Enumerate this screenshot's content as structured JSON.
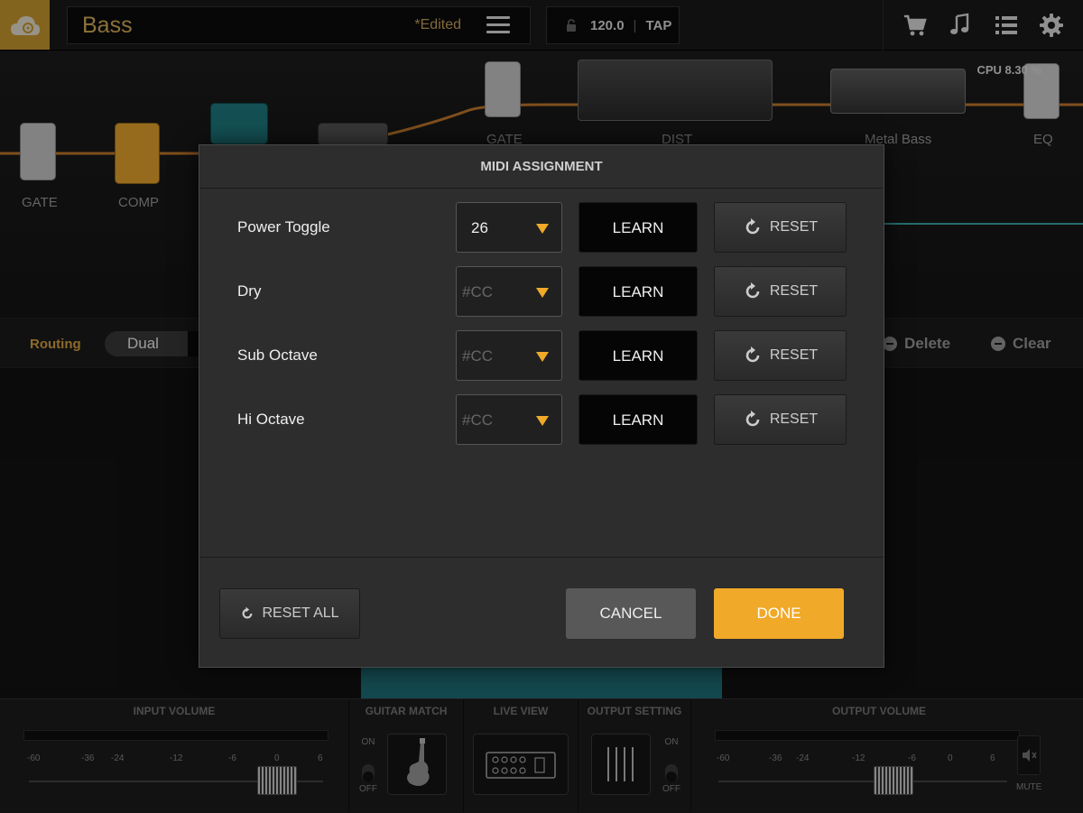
{
  "topbar": {
    "preset_name": "Bass",
    "edited_label": "*Edited",
    "tempo": "120.0",
    "tap_label": "TAP"
  },
  "chain": {
    "cpu_label": "CPU 8.30 %",
    "fx_labels": [
      "GATE",
      "COMP",
      "GATE",
      "DIST",
      "Metal Bass",
      "EQ"
    ]
  },
  "routing": {
    "label": "Routing",
    "mode": "Dual",
    "delete_label": "Delete",
    "clear_label": "Clear"
  },
  "bottom": {
    "input_volume_title": "INPUT VOLUME",
    "guitar_match_title": "GUITAR MATCH",
    "live_view_title": "LIVE VIEW",
    "output_setting_title": "OUTPUT SETTING",
    "output_volume_title": "OUTPUT VOLUME",
    "scale": [
      "-60",
      "-36",
      "-24",
      "-12",
      "-6",
      "0",
      "6"
    ],
    "on_label": "ON",
    "off_label": "OFF",
    "mute_label": "MUTE"
  },
  "dialog": {
    "title": "MIDI ASSIGNMENT",
    "rows": [
      {
        "label": "Power Toggle",
        "cc_value": "26",
        "learn": "LEARN",
        "reset": "RESET"
      },
      {
        "label": "Dry",
        "cc_placeholder": "#CC",
        "learn": "LEARN",
        "reset": "RESET"
      },
      {
        "label": "Sub Octave",
        "cc_placeholder": "#CC",
        "learn": "LEARN",
        "reset": "RESET"
      },
      {
        "label": "Hi Octave",
        "cc_placeholder": "#CC",
        "learn": "LEARN",
        "reset": "RESET"
      }
    ],
    "reset_all": "RESET ALL",
    "cancel": "CANCEL",
    "done": "DONE"
  },
  "colors": {
    "accent": "#f0a928",
    "brand": "#c99a2e",
    "preset_text": "#d8ae5a"
  },
  "icons": {
    "cloud": "cloud-icon",
    "menu": "hamburger-menu-icon",
    "lock": "lock-icon",
    "cart": "cart-icon",
    "music": "music-note-icon",
    "list": "list-icon",
    "settings": "gear-icon",
    "reset": "refresh-icon"
  }
}
